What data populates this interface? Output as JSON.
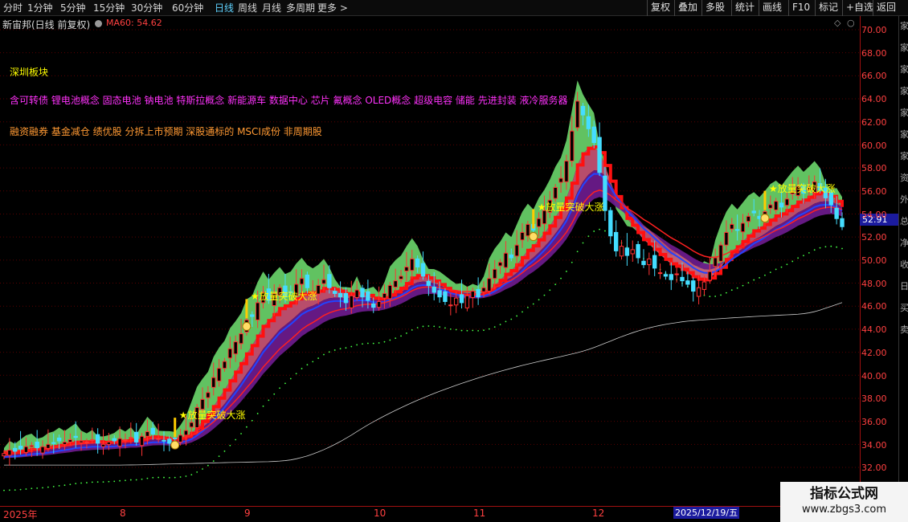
{
  "toolbar": {
    "periods": [
      "分时",
      "1分钟",
      "5分钟",
      "15分钟",
      "30分钟",
      "60分钟",
      "日线",
      "周线",
      "月线",
      "多周期",
      "更多 >"
    ],
    "active_period": "日线",
    "right_buttons": [
      "复权",
      "叠加",
      "多股",
      "统计",
      "画线",
      "F10",
      "标记",
      "+自选",
      "返回"
    ]
  },
  "chart": {
    "title": "新宙邦(日线 前复权)",
    "ma_label": "MA60: 54.62",
    "current_price": "52.91",
    "cursor_date": "2025/12/19/五"
  },
  "info": {
    "region": "深圳板块",
    "concepts": "含可转债 锂电池概念 固态电池 钠电池 特斯拉概念 新能源车 数据中心 芯片 氟概念 OLED概念 超级电容 储能 先进封装 液冷服务器",
    "tags": "融资融券 基金减仓 绩优股 分拆上市预期 深股通标的 MSCI成份 非周期股"
  },
  "signals": {
    "label": "★放量突破大涨",
    "count": 4
  },
  "price_axis": [
    "70.00",
    "68.00",
    "66.00",
    "64.00",
    "62.00",
    "60.00",
    "58.00",
    "56.00",
    "54.00",
    "52.00",
    "50.00",
    "48.00",
    "46.00",
    "44.00",
    "42.00",
    "40.00",
    "38.00",
    "36.00",
    "34.00",
    "32.00"
  ],
  "date_axis": [
    "2025年",
    "8",
    "9",
    "10",
    "11",
    "12"
  ],
  "side_strip": [
    "家",
    "家",
    "家",
    "家",
    "家",
    "家",
    "家",
    "资",
    "外",
    "总",
    "净",
    "收",
    "日",
    "买",
    "卖"
  ],
  "watermark": {
    "name": "指标公式网",
    "url": "www.zbgs3.com"
  },
  "chart_data": {
    "type": "candlestick",
    "ylim": [
      31,
      71
    ],
    "x_months": [
      "7",
      "8",
      "9",
      "10",
      "11",
      "12"
    ],
    "ma60_last": 54.62,
    "last_close": 52.91,
    "closes": [
      33.2,
      33.5,
      33.4,
      33.6,
      33.8,
      33.9,
      33.7,
      33.8,
      34.0,
      34.1,
      34.3,
      34.2,
      34.4,
      34.6,
      34.3,
      34.2,
      34.4,
      34.1,
      34.0,
      34.2,
      34.3,
      34.5,
      34.4,
      34.6,
      34.2,
      34.7,
      35.1,
      34.9,
      34.5,
      34.3,
      34.1,
      34.5,
      34.8,
      35.2,
      35.9,
      37.2,
      37.9,
      38.5,
      39.8,
      40.6,
      41.2,
      42.3,
      42.9,
      43.6,
      44.8,
      45.1,
      46.3,
      47.2,
      46.5,
      47.1,
      47.6,
      46.8,
      47.2,
      47.9,
      48.4,
      47.6,
      47.2,
      47.8,
      48.3,
      47.6,
      47.1,
      46.8,
      46.3,
      46.9,
      47.4,
      46.8,
      46.5,
      45.9,
      46.4,
      47.1,
      47.8,
      48.2,
      48.6,
      49.4,
      50.1,
      49.4,
      48.6,
      47.8,
      47.2,
      46.8,
      46.4,
      46.1,
      46.7,
      46.3,
      46.9,
      47.3,
      46.8,
      47.6,
      48.4,
      49.2,
      49.8,
      50.6,
      50.2,
      51.3,
      52.4,
      53.1,
      52.6,
      53.6,
      54.3,
      55.2,
      56.3,
      57.1,
      58.6,
      61.2,
      63.8,
      62.6,
      61.4,
      60.2,
      57.6,
      54.3,
      52.1,
      50.8,
      51.2,
      50.4,
      50.9,
      50.2,
      49.6,
      50.1,
      49.3,
      48.9,
      48.6,
      48.3,
      48.8,
      48.2,
      47.9,
      47.3,
      47.6,
      48.1,
      49.0,
      50.2,
      51.3,
      52.4,
      53.1,
      52.6,
      53.2,
      53.8,
      54.1,
      53.6,
      54.2,
      54.8,
      55.1,
      54.6,
      55.3,
      55.9,
      56.4,
      55.8,
      56.3,
      56.8,
      56.1,
      55.4,
      54.8,
      53.6,
      52.9
    ]
  }
}
